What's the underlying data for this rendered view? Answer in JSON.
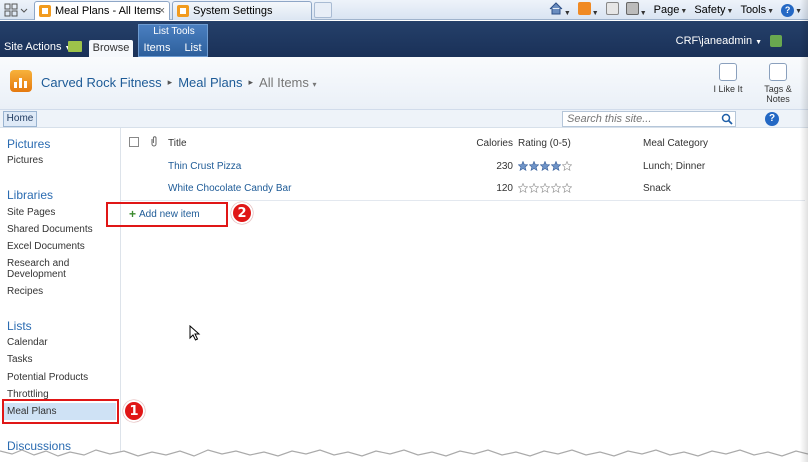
{
  "browser": {
    "tabs": [
      {
        "label": "Meal Plans - All Items",
        "active": true
      },
      {
        "label": "System Settings",
        "active": false
      }
    ],
    "close_glyph": "×",
    "tools": {
      "page": "Page",
      "safety": "Safety",
      "tools": "Tools",
      "help": "?"
    }
  },
  "ribbon": {
    "site_actions": "Site Actions",
    "browse_tab": "Browse",
    "context_group": "List Tools",
    "items_tab": "Items",
    "list_tab": "List",
    "user": "CRF\\janeadmin"
  },
  "title_area": {
    "site_name": "Carved Rock Fitness",
    "list_name": "Meal Plans",
    "view_name": "All Items",
    "actions": [
      {
        "label": "I Like It"
      },
      {
        "label": "Tags & Notes"
      }
    ]
  },
  "top_nav": {
    "home": "Home",
    "search_placeholder": "Search this site...",
    "help": "?"
  },
  "left_nav": {
    "pictures_head": "Pictures",
    "pictures": [
      "Pictures"
    ],
    "libraries_head": "Libraries",
    "libraries": [
      "Site Pages",
      "Shared Documents",
      "Excel Documents",
      "Research and Development",
      "Recipes"
    ],
    "lists_head": "Lists",
    "lists": [
      "Calendar",
      "Tasks",
      "Potential Products",
      "Throttling",
      "Meal Plans"
    ],
    "discussions_head": "Discussions"
  },
  "list": {
    "columns": {
      "title": "Title",
      "calories": "Calories",
      "rating": "Rating (0-5)",
      "category": "Meal Category"
    },
    "rows": [
      {
        "title": "Thin Crust Pizza",
        "calories": "230",
        "rating": 4,
        "category": "Lunch; Dinner"
      },
      {
        "title": "White Chocolate Candy Bar",
        "calories": "120",
        "rating": 0,
        "category": "Snack"
      }
    ],
    "add_new": "Add new item"
  },
  "annotations": {
    "badge1": "1",
    "badge2": "2"
  },
  "colors": {
    "accent_red": "#e01616",
    "link_blue": "#1e5b97",
    "ribbon_dark": "#1a3158"
  }
}
